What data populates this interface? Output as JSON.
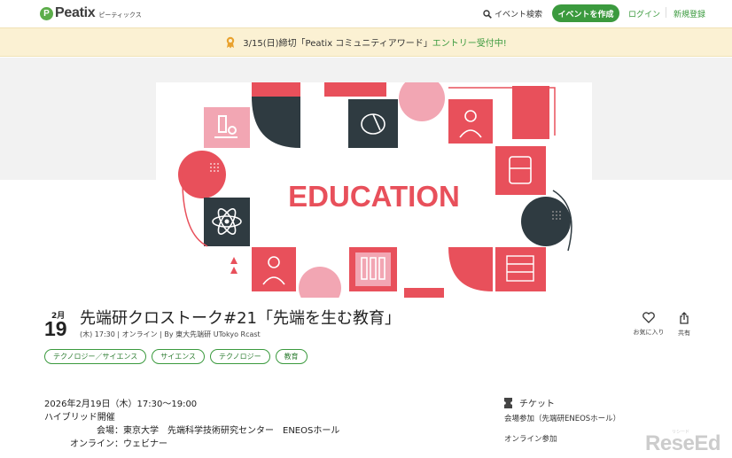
{
  "header": {
    "logo_mark": "P",
    "logo_text": "Peatix",
    "logo_sub": "ピーティックス",
    "search_label": "イベント検索",
    "create_label": "イベントを作成",
    "login_label": "ログイン",
    "signup_label": "新規登録"
  },
  "banner": {
    "text": "3/15(日)締切「Peatix コミュニティアワード」",
    "entry_text": "エントリー受付中!"
  },
  "hero": {
    "image_text": "EDUCATION"
  },
  "event": {
    "month": "2月",
    "day": "19",
    "title": "先端研クロストーク#21「先端を生む教育」",
    "meta": "(木) 17:30 |  オンライン |  By 東大先端研 UTokyo Rcast",
    "favorite_label": "お気に入り",
    "share_label": "共有",
    "tags": [
      "テクノロジー／サイエンス",
      "サイエンス",
      "テクノロジー",
      "教育"
    ]
  },
  "details": {
    "datetime": "2026年2月19日（木）17:30～19:00",
    "format": "ハイブリッド開催",
    "venue": "会場：東京大学　先端科学技術研究センター　ENEOSホール",
    "online": "オンライン：ウェビナー"
  },
  "tickets": {
    "heading": "チケット",
    "items": [
      "会場参加（先端研ENEOSホール）",
      "オンライン参加"
    ]
  },
  "watermark": {
    "text": "ReseEd",
    "small": "リシード"
  },
  "colors": {
    "brand_green": "#3b9a3e",
    "banner_bg": "#fbf1d3",
    "coral": "#e8505b",
    "pink": "#f2a6b3",
    "dark": "#2f3b41"
  }
}
